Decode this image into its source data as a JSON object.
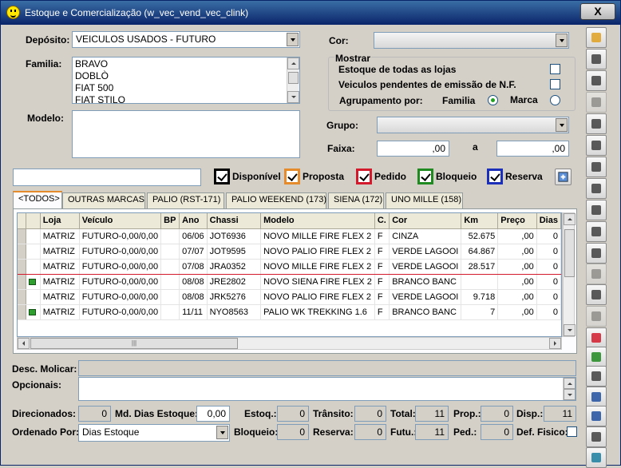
{
  "window": {
    "title": "Estoque e Comercialização (w_vec_vend_vec_clink)",
    "close_label": "X"
  },
  "filters": {
    "deposito_label": "Depósito:",
    "deposito_value": "VEICULOS USADOS - FUTURO",
    "familia_label": "Familia:",
    "familia_items": [
      "BRAVO",
      "DOBLÒ",
      "FIAT 500",
      "FIAT STILO"
    ],
    "modelo_label": "Modelo:",
    "cor_label": "Cor:",
    "mostrar_label": "Mostrar",
    "estoque_todas": "Estoque de todas as lojas",
    "pendentes_nf": "Veiculos pendentes de emissão de N.F.",
    "agrupamento_label": "Agrupamento por:",
    "agrupamento_familia": "Familia",
    "agrupamento_marca": "Marca",
    "grupo_label": "Grupo:",
    "faixa_label": "Faixa:",
    "faixa_de": ",00",
    "faixa_a_label": "a",
    "faixa_ate": ",00"
  },
  "legend": [
    {
      "label": "Disponível",
      "color": "#000000"
    },
    {
      "label": "Proposta",
      "color": "#e68b2c"
    },
    {
      "label": "Pedido",
      "color": "#d21a2c"
    },
    {
      "label": "Bloqueio",
      "color": "#1f8a1f"
    },
    {
      "label": "Reserva",
      "color": "#1c2fb8"
    }
  ],
  "tabs": [
    "<TODOS>",
    "OUTRAS MARCAS",
    "PALIO (RST-171)",
    "PALIO WEEKEND (173)",
    "SIENA (172)",
    "UNO MILLE (158)"
  ],
  "grid": {
    "columns": [
      "Loja",
      "Veículo",
      "BP",
      "Ano",
      "Chassi",
      "Modelo",
      "C.",
      "Cor",
      "Km",
      "Preço",
      "Dias"
    ],
    "rows": [
      {
        "flag": false,
        "cells": [
          "MATRIZ",
          "FUTURO-0,00/0,00",
          "",
          "06/06",
          "JOT6936",
          "NOVO MILLE FIRE FLEX 2",
          "F",
          "CINZA",
          "52.675",
          ",00",
          "0"
        ]
      },
      {
        "flag": false,
        "cells": [
          "MATRIZ",
          "FUTURO-0,00/0,00",
          "",
          "07/07",
          "JOT9595",
          "NOVO PALIO FIRE FLEX 2",
          "F",
          "VERDE LAGOOI",
          "64.867",
          ",00",
          "0"
        ]
      },
      {
        "flag": false,
        "cells": [
          "MATRIZ",
          "FUTURO-0,00/0,00",
          "",
          "07/08",
          "JRA0352",
          "NOVO MILLE FIRE FLEX 2",
          "F",
          "VERDE LAGOOI",
          "28.517",
          ",00",
          "0"
        ]
      },
      {
        "flag": true,
        "cells": [
          "MATRIZ",
          "FUTURO-0,00/0,00",
          "",
          "08/08",
          "JRE2802",
          "NOVO SIENA FIRE FLEX 2",
          "F",
          "BRANCO BANC",
          "",
          ",00",
          "0"
        ]
      },
      {
        "flag": false,
        "cells": [
          "MATRIZ",
          "FUTURO-0,00/0,00",
          "",
          "08/08",
          "JRK5276",
          "NOVO PALIO FIRE FLEX 2",
          "F",
          "VERDE LAGOOI",
          "9.718",
          ",00",
          "0"
        ]
      },
      {
        "flag": true,
        "cells": [
          "MATRIZ",
          "FUTURO-0,00/0,00",
          "",
          "11/11",
          "NYO8563",
          "PALIO WK TREKKING 1.6",
          "F",
          "BRANCO BANC",
          "7",
          ",00",
          "0"
        ]
      }
    ],
    "selected_row": 2
  },
  "footer": {
    "desc_molicar_label": "Desc. Molicar:",
    "opcionais_label": "Opcionais:",
    "direcionados_label": "Direcionados:",
    "direcionados_value": "0",
    "md_dias_label": "Md. Dias Estoque:",
    "md_dias_value": "0,00",
    "estoq_label": "Estoq.:",
    "estoq_value": "0",
    "transito_label": "Trânsito:",
    "transito_value": "0",
    "total_label": "Total:",
    "total_value": "11",
    "prop_label": "Prop.:",
    "prop_value": "0",
    "disp_label": "Disp.:",
    "disp_value": "11",
    "ordenado_label": "Ordenado Por:",
    "ordenado_value": "Dias Estoque",
    "bloqueio_label": "Bloqueio:",
    "bloqueio_value": "0",
    "reserva_label": "Reserva:",
    "reserva_value": "0",
    "futu_label": "Futu.:",
    "futu_value": "11",
    "ped_label": "Ped.:",
    "ped_value": "0",
    "def_fisico_label": "Def. Fisico:"
  },
  "toolbar_icons": [
    "open-folder-icon",
    "search-document-icon",
    "car-settings-icon",
    "dollar-icon",
    "money-bag-icon",
    "calculator-icon",
    "wrench-icon",
    "car-wash-icon",
    "tire-icon",
    "camera-icon",
    "car-front-icon",
    "list-icon",
    "globe-icon",
    "dollar-stack-icon",
    "red-flag-icon",
    "green-flag-icon",
    "table-list-icon",
    "grid-icon",
    "edit-icon",
    "car-side-icon",
    "exit-icon"
  ]
}
